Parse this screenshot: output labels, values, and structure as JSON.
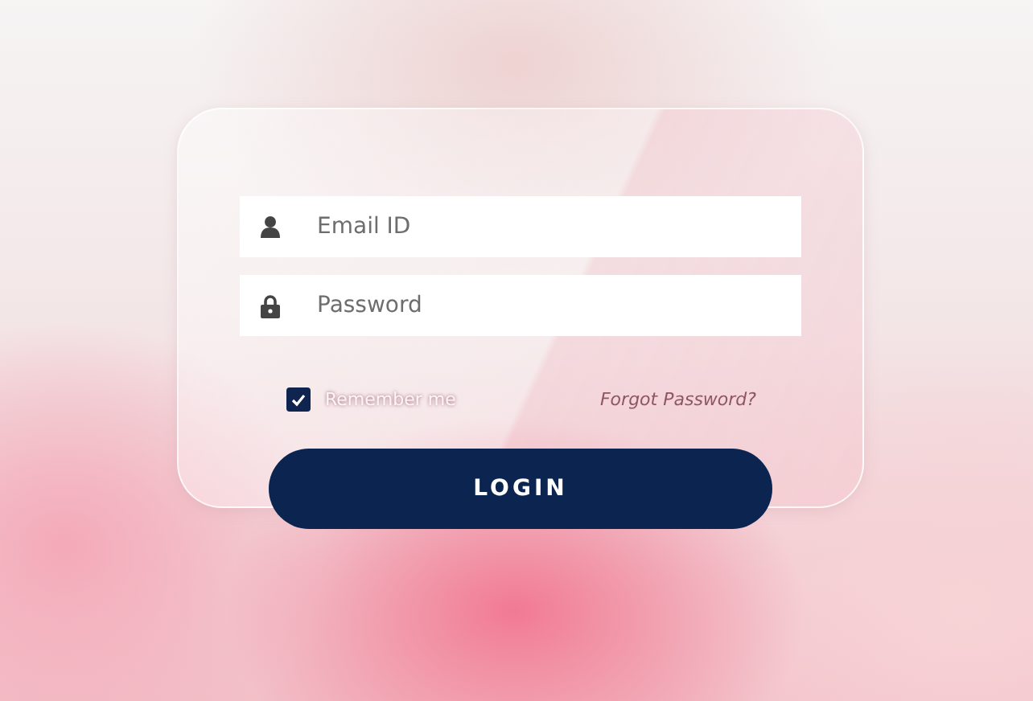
{
  "fields": [
    {
      "kind": "user",
      "placeholder": "Email ID"
    },
    {
      "kind": "lock",
      "placeholder": "Password"
    }
  ],
  "remember": {
    "label": "Remember me",
    "checked": true
  },
  "forgot_link": "Forgot Password?",
  "login_button": "LOGIN"
}
